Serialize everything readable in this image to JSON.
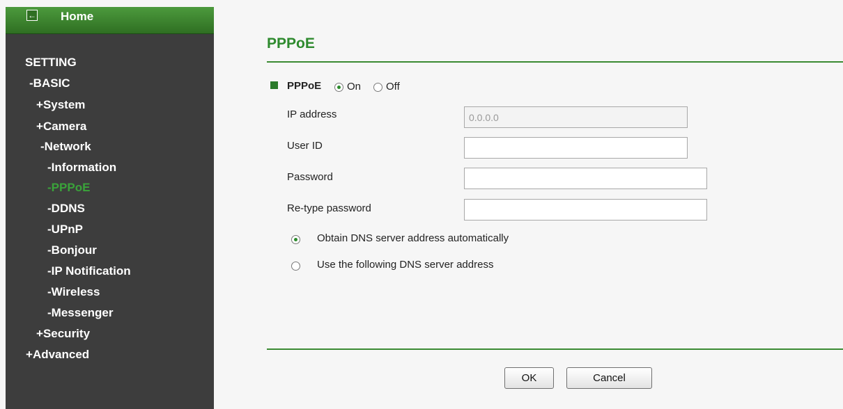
{
  "sidebar": {
    "home_label": "Home",
    "items": [
      {
        "label": "SETTING",
        "prefix": ""
      },
      {
        "label": "BASIC",
        "prefix": "-"
      },
      {
        "label": "System",
        "prefix": "+"
      },
      {
        "label": "Camera",
        "prefix": "+"
      },
      {
        "label": "Network",
        "prefix": "-"
      },
      {
        "label": "Information",
        "prefix": "-"
      },
      {
        "label": "PPPoE",
        "prefix": "-"
      },
      {
        "label": "DDNS",
        "prefix": "-"
      },
      {
        "label": "UPnP",
        "prefix": "-"
      },
      {
        "label": "Bonjour",
        "prefix": "-"
      },
      {
        "label": "IP Notification",
        "prefix": "-"
      },
      {
        "label": "Wireless",
        "prefix": "-"
      },
      {
        "label": "Messenger",
        "prefix": "-"
      },
      {
        "label": "Security",
        "prefix": "+"
      },
      {
        "label": "Advanced",
        "prefix": "+"
      }
    ]
  },
  "page": {
    "title": "PPPoE",
    "section_label": "PPPoE",
    "on_label": "On",
    "off_label": "Off",
    "pppoe_state": "On",
    "fields": {
      "ip_label": "IP address",
      "ip_value": "0.0.0.0",
      "userid_label": "User ID",
      "userid_value": "",
      "password_label": "Password",
      "password_value": "",
      "retype_label": "Re-type password",
      "retype_value": ""
    },
    "dns_auto_label": "Obtain DNS server address automatically",
    "dns_manual_label": "Use the following DNS server address",
    "dns_mode": "auto",
    "ok_label": "OK",
    "cancel_label": "Cancel"
  },
  "colors": {
    "accent": "#2e8a2e",
    "active_nav": "#3aa33a",
    "sidebar_bg": "#3d3d3d",
    "home_bar": "#2f6f22"
  }
}
